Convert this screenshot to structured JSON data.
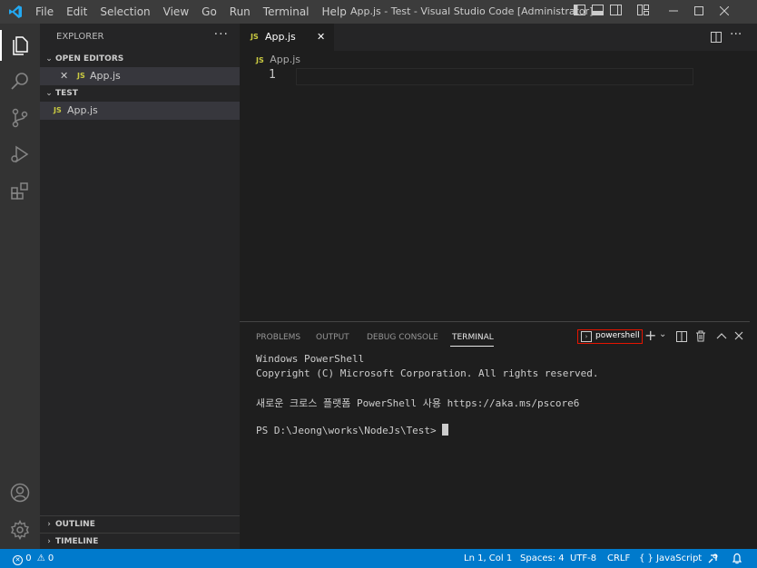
{
  "titlebar": {
    "menu": [
      "File",
      "Edit",
      "Selection",
      "View",
      "Go",
      "Run",
      "Terminal",
      "Help"
    ],
    "title": "App.js - Test - Visual Studio Code [Administrator]"
  },
  "sidebar": {
    "title": "EXPLORER",
    "more": "···",
    "open_editors": {
      "header": "OPEN EDITORS",
      "files": [
        {
          "badge": "JS",
          "name": "App.js",
          "close": "✕"
        }
      ]
    },
    "folder": {
      "header": "TEST",
      "files": [
        {
          "badge": "JS",
          "name": "App.js"
        }
      ]
    },
    "outline": "OUTLINE",
    "timeline": "TIMELINE"
  },
  "editor": {
    "tab": {
      "badge": "JS",
      "name": "App.js",
      "close": "✕"
    },
    "breadcrumb": {
      "badge": "JS",
      "name": "App.js"
    },
    "line_number": "1"
  },
  "panel": {
    "tabs": [
      "PROBLEMS",
      "OUTPUT",
      "DEBUG CONSOLE",
      "TERMINAL"
    ],
    "active_tab": "TERMINAL",
    "terminal_name": "powershell",
    "terminal_lines": [
      "Windows PowerShell",
      "Copyright (C) Microsoft Corporation. All rights reserved.",
      "",
      "새로운 크로스 플랫폼 PowerShell 사용 https://aka.ms/pscore6",
      "",
      "PS D:\\Jeong\\works\\NodeJs\\Test> "
    ]
  },
  "statusbar": {
    "errors": "0",
    "warnings": "0",
    "position": "Ln 1, Col 1",
    "spaces": "Spaces: 4",
    "encoding": "UTF-8",
    "eol": "CRLF",
    "language": "JavaScript"
  },
  "colors": {
    "accent": "#007acc",
    "titlebar": "#3c3c3c",
    "activitybar": "#333333",
    "sidebar": "#252526",
    "editor": "#1e1e1e",
    "js_badge": "#cbcb41",
    "highlight_box": "#e51400"
  }
}
